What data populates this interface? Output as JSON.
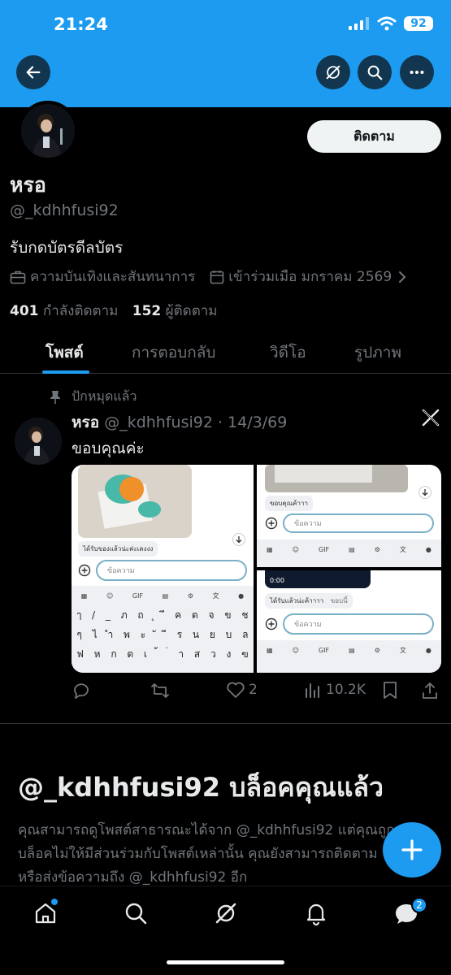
{
  "status": {
    "time": "21:24",
    "battery": "92"
  },
  "profile": {
    "name": "หรอ",
    "handle": "@_kdhhfusi92",
    "bio": "รับกดบัตรดีลบัตร",
    "category": "ความบันเทิงและสันทนาการ",
    "joined": "เข้าร่วมเมือ มกราคม 2569",
    "following_count": "401",
    "following_label": "กำลังติดตาม",
    "followers_count": "152",
    "followers_label": "ผู้ติดตาม",
    "follow_button": "ติดตาม"
  },
  "tabs": [
    {
      "label": "โพสต์",
      "active": true
    },
    {
      "label": "การตอบกลับ",
      "active": false
    },
    {
      "label": "วิดีโอ",
      "active": false
    },
    {
      "label": "รูปภาพ",
      "active": false
    }
  ],
  "post": {
    "pinned_label": "ปักหมุดแล้ว",
    "author": "หรอ",
    "handle_date": "@_kdhhfusi92 · 14/3/69",
    "text": "ขอบคุณค่ะ",
    "likes": "2",
    "views": "10.2K",
    "media": {
      "left_bubble": "ได้รับของแล้วน่ะค่ะเดงงง",
      "input_placeholder": "ข้อความ",
      "kb_gif": "GIF",
      "kb_row1": [
        "ๅ",
        "/",
        "_",
        "ภ",
        "ถ",
        "ุ",
        "ึ",
        "ค",
        "ต",
        "จ",
        "ข",
        "ช"
      ],
      "kb_row2": [
        "ๆ",
        "ไ",
        "ำ",
        "พ",
        "ะ",
        "ั",
        "ี",
        "ร",
        "น",
        "ย",
        "บ",
        "ล"
      ],
      "kb_row3": [
        "ฟ",
        "ห",
        "ก",
        "ด",
        "เ",
        "้",
        "่",
        "า",
        "ส",
        "ว",
        "ง",
        "ฃ"
      ],
      "top_right_bubble": "ขอบคุณค้าาา",
      "video_time": "0:00",
      "bottom_right_bubble": "ได้รับแล้วน่ะค้าาาา",
      "bottom_right_tail": "ขอบนี้"
    }
  },
  "blocked": {
    "handle": "@_kdhhfusi92",
    "title_suffix": "บล็อคคุณแล้ว",
    "description": "คุณสามารถดูโพสต์สาธารณะได้จาก @_kdhhfusi92 แต่คุณถูกบล็อคไม่ให้มีส่วนร่วมกับโพสต์เหล่านั้น คุณยังสามารถติดตามหรือส่งข้อความถึง @_kdhhfusi92 อีก"
  },
  "nav": {
    "messages_badge": "2"
  },
  "colors": {
    "accent": "#1d9bf0",
    "background": "#000000",
    "muted": "#71767b",
    "text": "#e7e9ea"
  },
  "icons": [
    "back-arrow-icon",
    "grok-icon",
    "search-icon",
    "more-icon",
    "briefcase-icon",
    "calendar-icon",
    "chevron-right-icon",
    "pin-icon",
    "x-logo-icon",
    "reply-icon",
    "retweet-icon",
    "heart-icon",
    "views-icon",
    "bookmark-icon",
    "share-icon",
    "compose-icon",
    "home-icon",
    "messages-icon",
    "notifications-icon"
  ]
}
